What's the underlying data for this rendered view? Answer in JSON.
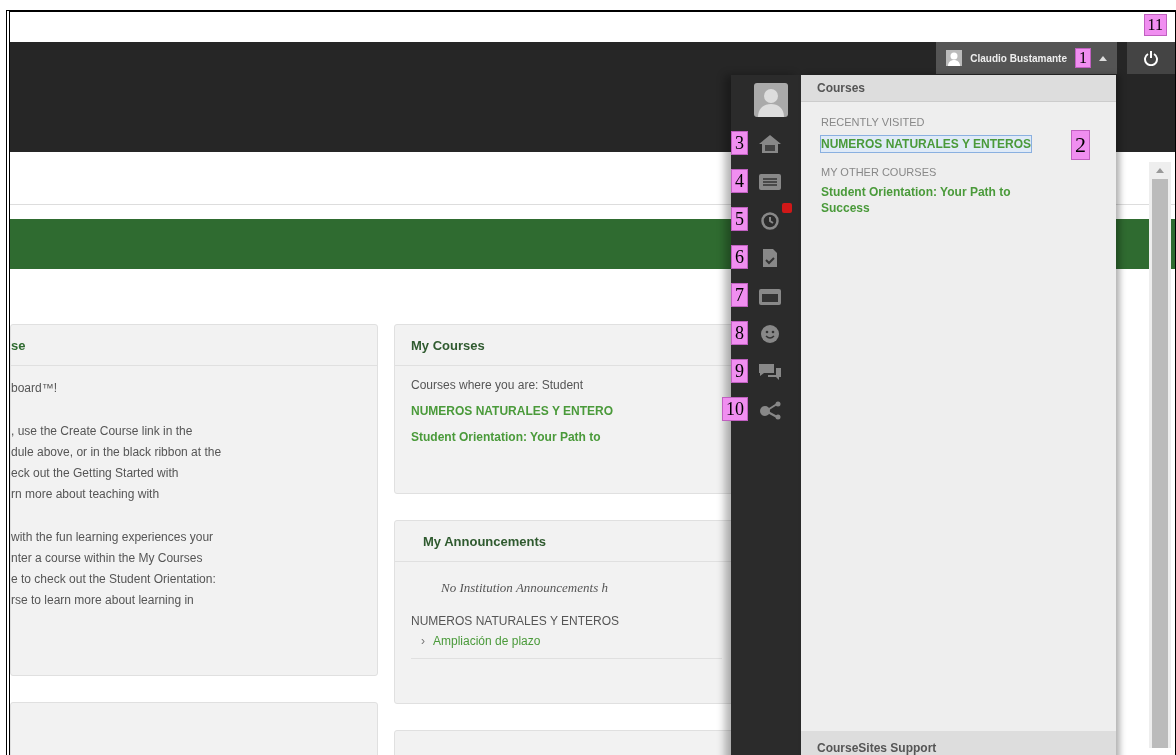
{
  "header": {
    "user_name": "Claudio Bustamante",
    "user_callout": "1",
    "power_callout": "11"
  },
  "welcome_module": {
    "title": "se",
    "paragraphs": [
      [
        "board™!"
      ],
      [
        ", use the Create Course link in the",
        "dule above, or in the black ribbon at the",
        "eck out the Getting Started with",
        "rn more about teaching with"
      ],
      [
        "with the fun learning experiences your",
        "nter a course within the My Courses",
        "e to check out the Student Orientation:",
        "rse to learn more about learning in"
      ]
    ]
  },
  "my_courses": {
    "title": "My Courses",
    "role_line": "Courses where you are: Student",
    "courses": [
      "NUMEROS NATURALES Y ENTERO",
      "Student Orientation: Your Path to"
    ]
  },
  "announcements": {
    "title": "My Announcements",
    "notice": "No Institution Announcements h",
    "course": "NUMEROS NATURALES Y ENTEROS",
    "items": [
      {
        "marker": "›",
        "label": "Ampliación de plazo"
      }
    ]
  },
  "nav_rail": {
    "items": [
      {
        "kind": "home",
        "callout": "3",
        "badge": false
      },
      {
        "kind": "list",
        "callout": "4",
        "badge": false
      },
      {
        "kind": "alarm",
        "callout": "5",
        "badge": true
      },
      {
        "kind": "document",
        "callout": "6",
        "badge": false
      },
      {
        "kind": "calendar",
        "callout": "7",
        "badge": false
      },
      {
        "kind": "smiley",
        "callout": "8",
        "badge": false
      },
      {
        "kind": "chat",
        "callout": "9",
        "badge": false
      },
      {
        "kind": "share",
        "callout": "10",
        "badge": false
      }
    ]
  },
  "courses_menu": {
    "title": "Courses",
    "sections": [
      {
        "heading": "RECENTLY VISITED",
        "links": [
          {
            "label": "NUMEROS NATURALES Y ENTEROS",
            "selected": true,
            "callout": "2"
          }
        ]
      },
      {
        "heading": "MY OTHER COURSES",
        "links": [
          {
            "label": "Student Orientation: Your Path to Success",
            "selected": false
          }
        ]
      }
    ],
    "footer": "CourseSites Support"
  }
}
